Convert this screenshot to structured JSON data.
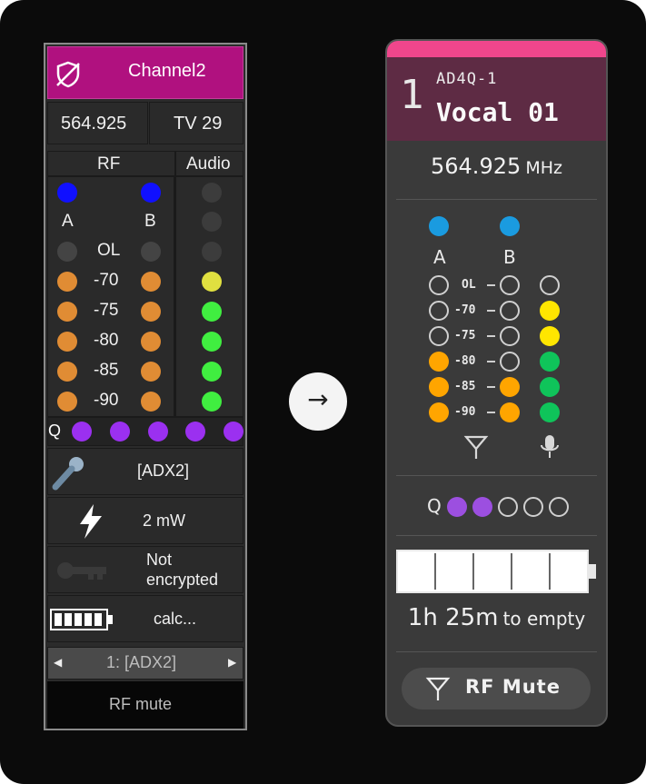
{
  "old_panel": {
    "channel_title": "Channel2",
    "frequency": "564.925",
    "tv_channel": "TV 29",
    "rf_header": "RF",
    "audio_header": "Audio",
    "antenna_a": "A",
    "antenna_b": "B",
    "levels": [
      "OL",
      "-70",
      "-75",
      "-80",
      "-85",
      "-90"
    ],
    "q_label": "Q",
    "device": "[ADX2]",
    "power": "2 mW",
    "encryption": "Not encrypted",
    "battery": "calc...",
    "nav_label": "1: [ADX2]",
    "rf_mute": "RF mute",
    "colors": {
      "title_bg": "#b0117f",
      "rf_dot": "#f29a3a",
      "antenna_dot": "#1010ff",
      "audio_yellow": "#e0e040",
      "audio_green": "#40ee40",
      "q_purple": "#9b30f0"
    }
  },
  "transition_icon": "right-arrow-icon",
  "new_panel": {
    "channel_number": "1",
    "device_id": "AD4Q-1",
    "channel_name": "Vocal 01",
    "frequency": "564.925",
    "frequency_unit": "MHz",
    "antenna_a": "A",
    "antenna_b": "B",
    "levels": [
      "OL",
      "-70",
      "-75",
      "-80",
      "-85",
      "-90"
    ],
    "q_label": "Q",
    "quality_filled": 2,
    "quality_total": 5,
    "runtime": "1h 25m",
    "runtime_suffix": "to empty",
    "rf_mute": "RF Mute",
    "colors": {
      "accent": "#f0468c",
      "header_bg": "#5e2b44",
      "antenna_dot": "#1a9be0",
      "rf_orange": "#ffa500",
      "audio_yellow": "#ffe600",
      "audio_green": "#0fc45a",
      "q_purple": "#9c4fe0"
    }
  }
}
